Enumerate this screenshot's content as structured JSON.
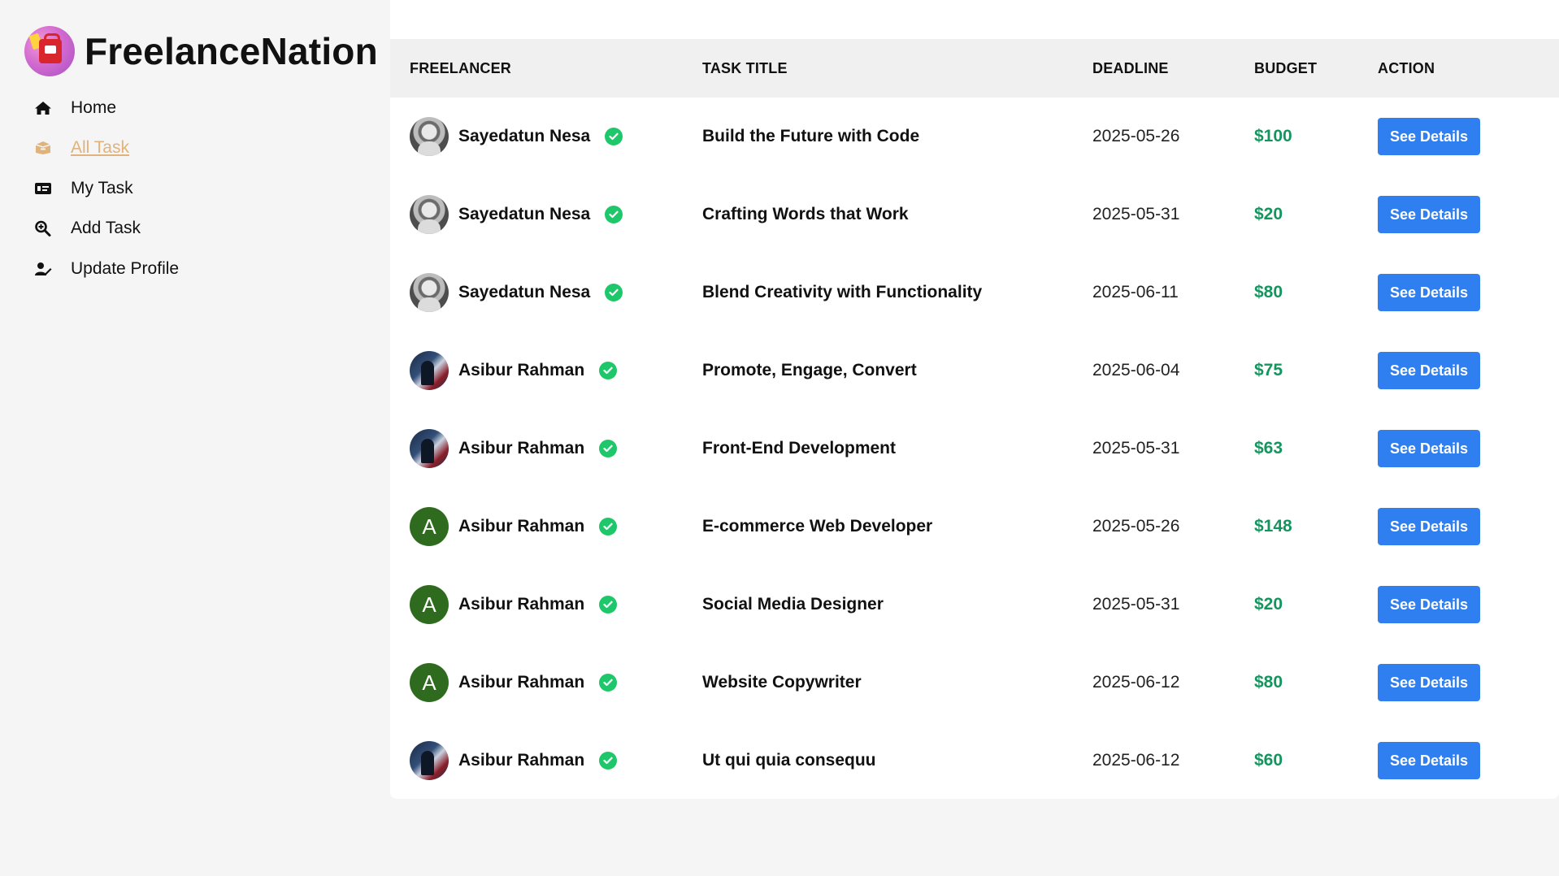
{
  "brand": {
    "name": "FreelanceNation",
    "logo_icon": "shopping-bag-logo"
  },
  "sidebar": {
    "items": [
      {
        "label": "Home",
        "icon": "home-icon",
        "active": false
      },
      {
        "label": "All Task",
        "icon": "box-icon",
        "active": true
      },
      {
        "label": "My Task",
        "icon": "id-card-icon",
        "active": false
      },
      {
        "label": "Add Task",
        "icon": "search-plus-icon",
        "active": false
      },
      {
        "label": "Update Profile",
        "icon": "user-edit-icon",
        "active": false
      }
    ]
  },
  "table": {
    "headers": {
      "freelancer": "FREELANCER",
      "task_title": "TASK TITLE",
      "deadline": "DEADLINE",
      "budget": "BUDGET",
      "action": "ACTION"
    },
    "rows": [
      {
        "freelancer": "Sayedatun Nesa",
        "avatar": "photo-a",
        "task_title": "Build the Future with Code",
        "deadline": "2025-05-26",
        "budget": "$100",
        "action": "See Details"
      },
      {
        "freelancer": "Sayedatun Nesa",
        "avatar": "photo-a",
        "task_title": "Crafting Words that Work",
        "deadline": "2025-05-31",
        "budget": "$20",
        "action": "See Details"
      },
      {
        "freelancer": "Sayedatun Nesa",
        "avatar": "photo-a",
        "task_title": "Blend Creativity with Functionality",
        "deadline": "2025-06-11",
        "budget": "$80",
        "action": "See Details"
      },
      {
        "freelancer": "Asibur Rahman",
        "avatar": "photo-b",
        "task_title": "Promote, Engage, Convert",
        "deadline": "2025-06-04",
        "budget": "$75",
        "action": "See Details"
      },
      {
        "freelancer": "Asibur Rahman",
        "avatar": "photo-b",
        "task_title": "Front-End Development",
        "deadline": "2025-05-31",
        "budget": "$63",
        "action": "See Details"
      },
      {
        "freelancer": "Asibur Rahman",
        "avatar": "letter",
        "avatar_letter": "A",
        "task_title": "E-commerce Web Developer",
        "deadline": "2025-05-26",
        "budget": "$148",
        "action": "See Details"
      },
      {
        "freelancer": "Asibur Rahman",
        "avatar": "letter",
        "avatar_letter": "A",
        "task_title": "Social Media Designer",
        "deadline": "2025-05-31",
        "budget": "$20",
        "action": "See Details"
      },
      {
        "freelancer": "Asibur Rahman",
        "avatar": "letter",
        "avatar_letter": "A",
        "task_title": "Website Copywriter",
        "deadline": "2025-06-12",
        "budget": "$80",
        "action": "See Details"
      },
      {
        "freelancer": "Asibur Rahman",
        "avatar": "photo-b",
        "task_title": "Ut qui quia consequu",
        "deadline": "2025-06-12",
        "budget": "$60",
        "action": "See Details"
      }
    ]
  },
  "colors": {
    "accent_button": "#2f7ff0",
    "budget_text": "#14955e",
    "verified_badge": "#1fc76b",
    "active_nav": "#e0b27c",
    "letter_avatar": "#2e6b1f"
  }
}
